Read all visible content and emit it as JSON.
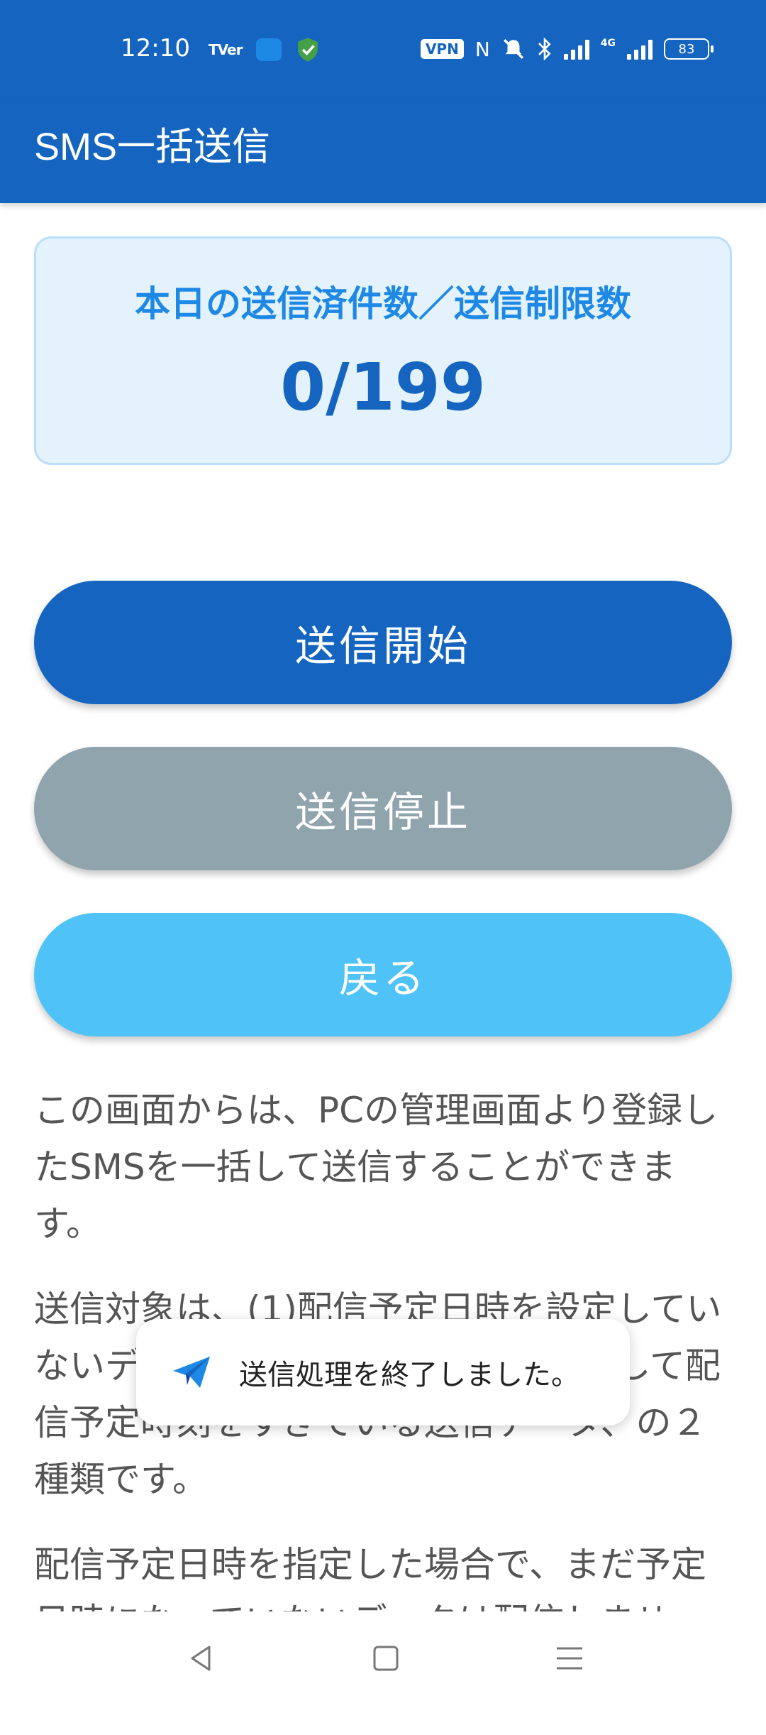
{
  "status_bar": {
    "time": "12:10",
    "tver_label": "TVer",
    "vpn_label": "VPN",
    "nfc_label": "N",
    "network_label": "4G",
    "battery_level": "83",
    "icons": [
      "tver-icon",
      "app-icon",
      "shield-icon",
      "vpn-icon",
      "nfc-icon",
      "mute-icon",
      "bluetooth-icon",
      "signal-icon",
      "signal-4g-icon",
      "battery-icon"
    ]
  },
  "app_bar": {
    "title": "SMS一括送信"
  },
  "counter": {
    "label": "本日の送信済件数／送信制限数",
    "value": "0/199"
  },
  "buttons": {
    "start": "送信開始",
    "stop": "送信停止",
    "back": "戻る"
  },
  "description": {
    "paragraph1": "この画面からは、PCの管理画面より登録したSMSを一括して送信することができます。",
    "paragraph2": "送信対象は、(1)配信予定日時を設定していないデータ、(2)配信予定日時を設定して配信予定時刻をすぎている送信データ、の２種類です。",
    "paragraph3": "配信予定日時を指定した場合で、まだ予定日時になっていないデータは配信しません。"
  },
  "toast": {
    "message": "送信処理を終了しました。",
    "icon": "paper-plane-icon"
  },
  "nav_bar": {
    "icons": [
      "back-icon",
      "home-icon",
      "menu-icon"
    ]
  },
  "colors": {
    "primary": "#1565C0",
    "card_bg": "#E3F2FD",
    "stop_button": "#90A4AE",
    "back_button": "#4FC3F7",
    "label_blue": "#1E88E5"
  }
}
